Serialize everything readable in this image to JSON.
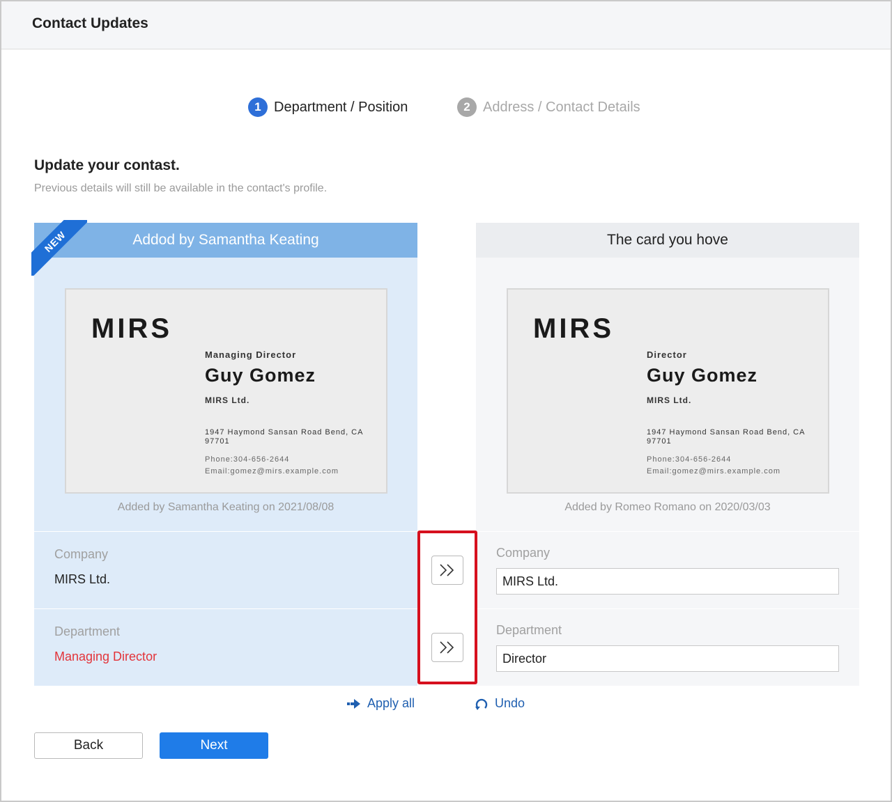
{
  "header": {
    "title": "Contact Updates"
  },
  "steps": [
    {
      "number": "1",
      "label": "Department / Position"
    },
    {
      "number": "2",
      "label": "Address / Contact Details"
    }
  ],
  "intro": {
    "heading": "Update your contast.",
    "subheading": "Previous details will still be available in the contact's profile."
  },
  "new_card": {
    "badge": "NEW",
    "header": "Addod by Samantha Keating",
    "card": {
      "logo": "MIRS",
      "title": "Managing Director",
      "name": "Guy Gomez",
      "company": "MIRS Ltd.",
      "address": "1947 Haymond Sansan Road Bend, CA 97701",
      "phone": "Phone:304-656-2644",
      "email": "Email:gomez@mirs.example.com"
    },
    "added_by": "Added by Samantha Keating on 2021/08/08",
    "fields": {
      "company_label": "Company",
      "company_value": "MIRS Ltd.",
      "department_label": "Department",
      "department_value": "Managing Director"
    }
  },
  "current_card": {
    "header": "The card you hove",
    "card": {
      "logo": "MIRS",
      "title": "Director",
      "name": "Guy Gomez",
      "company": "MIRS Ltd.",
      "address": "1947 Haymond Sansan Road Bend, CA 97701",
      "phone": "Phone:304-656-2644",
      "email": "Email:gomez@mirs.example.com"
    },
    "added_by": "Added by Romeo Romano on 2020/03/03",
    "fields": {
      "company_label": "Company",
      "company_value": "MIRS Ltd.",
      "department_label": "Department",
      "department_value": "Director"
    }
  },
  "actions": {
    "apply_all": "Apply all",
    "undo": "Undo",
    "back": "Back",
    "next": "Next"
  },
  "colors": {
    "accent": "#1f7ce8",
    "changed": "#e3343a",
    "highlight": "#d6101e"
  }
}
